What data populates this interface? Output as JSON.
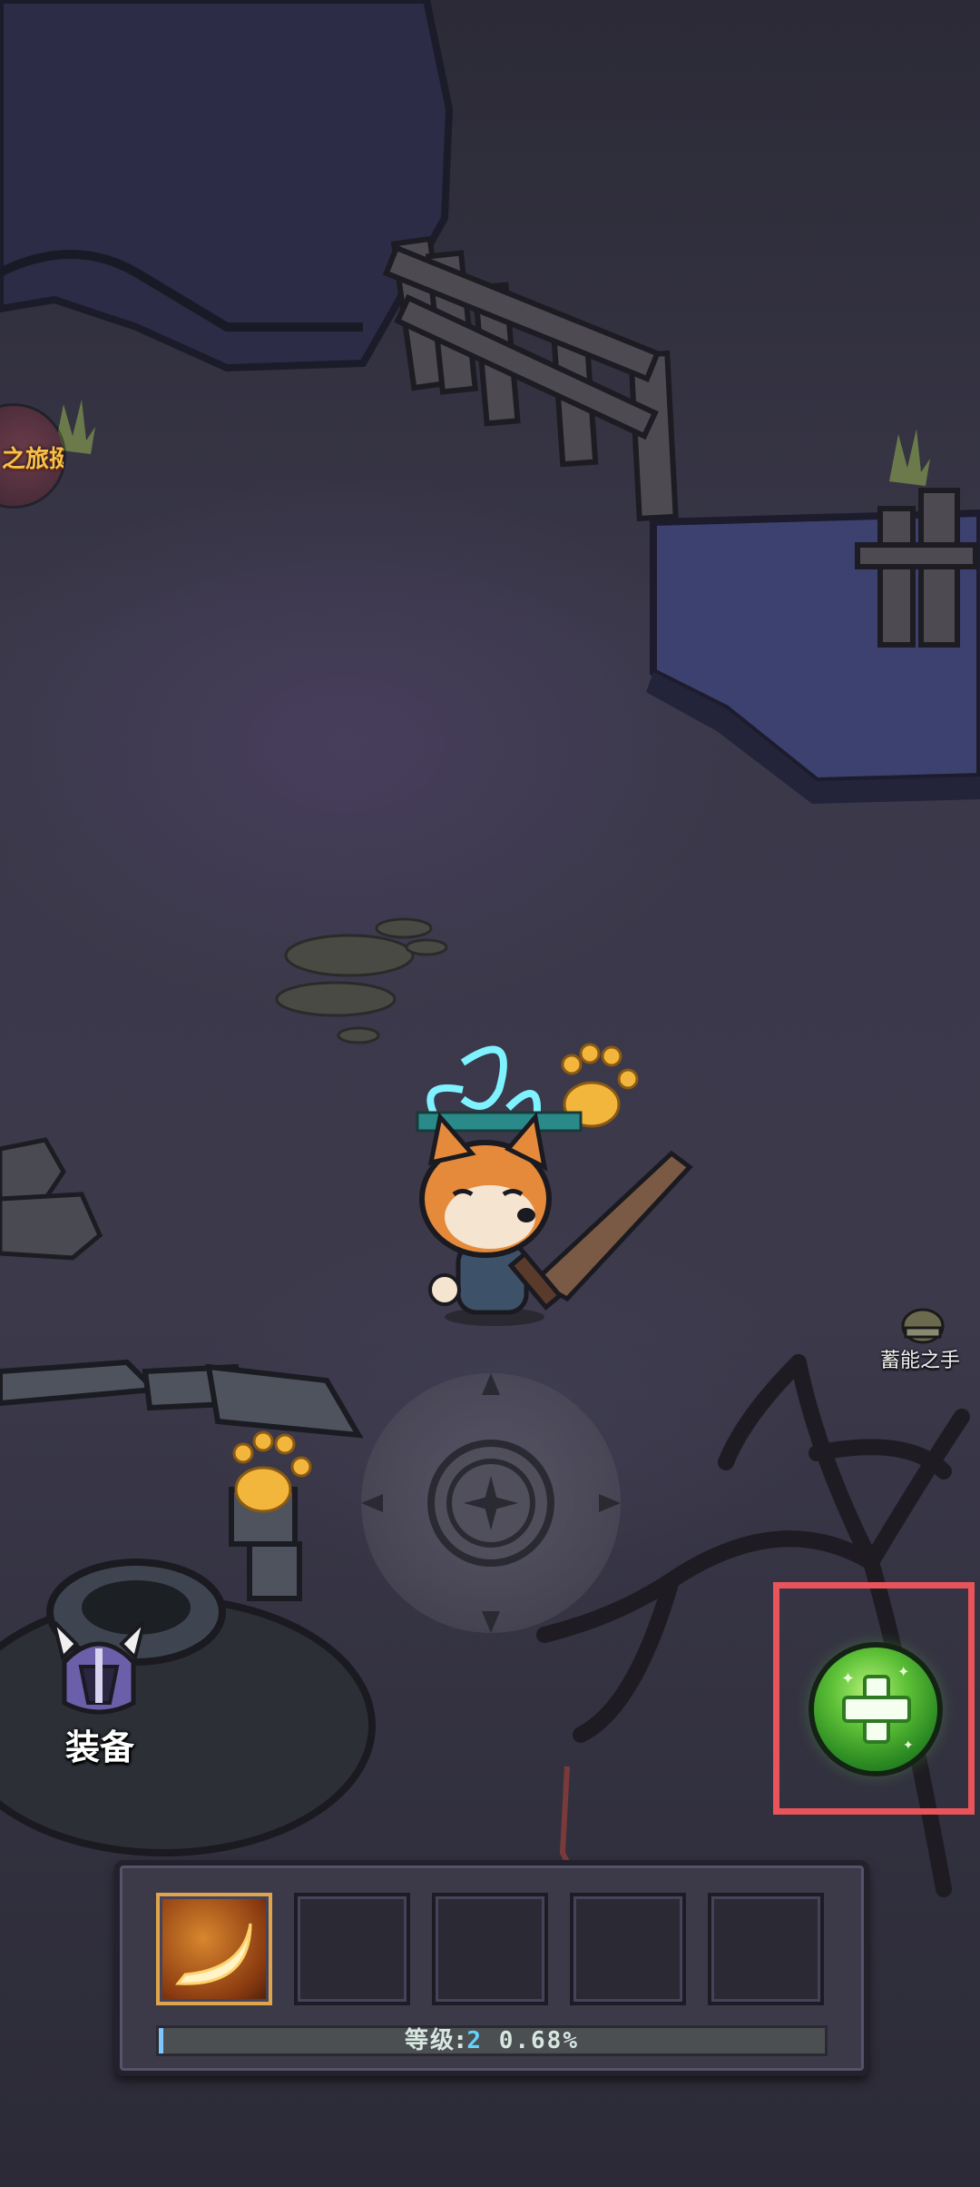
{
  "event_badge": {
    "label": "之旅挺"
  },
  "charge_hand": {
    "label": "蓄能之手"
  },
  "equipment": {
    "label": "装备"
  },
  "skill_bar": {
    "slots": [
      {
        "name": "crescent-slash-skill",
        "filled": true
      },
      {
        "name": "empty",
        "filled": false
      },
      {
        "name": "empty",
        "filled": false
      },
      {
        "name": "empty",
        "filled": false
      },
      {
        "name": "empty",
        "filled": false
      }
    ]
  },
  "level": {
    "label": "等级:",
    "value": "2",
    "progress_text": "0.68%",
    "progress": 0.0068
  },
  "heal_button": {
    "icon": "green-plus-heal-icon",
    "highlighted": true
  },
  "colors": {
    "highlight": "#e8545a",
    "xp_accent": "#5fd4ff",
    "heal_green": "#5fc238"
  }
}
